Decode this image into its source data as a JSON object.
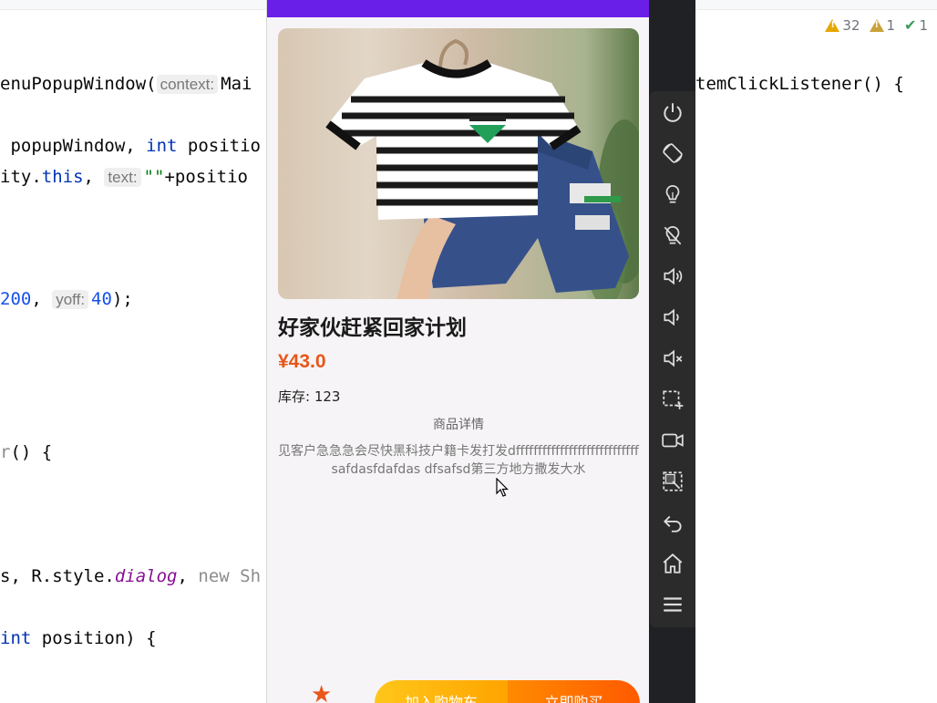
{
  "ide": {
    "inspections": {
      "warnings": "32",
      "weak_warnings": "1",
      "ok": "1"
    },
    "lines": {
      "l1_a": "enuPopupWindow(",
      "l1_hint": "context:",
      "l1_b": "Mai",
      "l1_tail": "temClickListener() {",
      "l2_a": " popupWindow, ",
      "l2_kw": "int",
      "l2_b": " positio",
      "l3_a": "ity.",
      "l3_kw": "this",
      "l3_b": ", ",
      "l3_hint": "text:",
      "l3_str": "\"\"",
      "l3_c": "+positio",
      "l4_num": "200",
      "l4_a": ", ",
      "l4_hint": "yoff:",
      "l4_num2": "40",
      "l4_b": ");",
      "l5_gray": "r",
      "l5_a": "() {",
      "l6_a": "s, R.style.",
      "l6_ital": "dialog",
      "l6_b": ", ",
      "l6_gray": "new Sh",
      "l7_kw": "int",
      "l7_a": " position) {"
    }
  },
  "product": {
    "title": "好家伙赶紧回家计划",
    "price": "¥43.0",
    "stock": "库存: 123",
    "detail_heading": "商品详情",
    "detail_text": "见客户急急急会尽快黑科技户籍卡发打发dffffffffffffffffffffffffffffsafdasfdafdas dfsafsd第三方地方撒发大水",
    "add_to_cart": "加入购物车",
    "buy_now": "立即购买"
  },
  "emulator_toolbar": [
    "power-icon",
    "rotate-icon",
    "bulb-icon",
    "bulb-off-icon",
    "volume-up-icon",
    "volume-down-icon",
    "volume-mute-icon",
    "screenshot-icon",
    "camera-record-icon",
    "screen-region-icon",
    "back-icon",
    "home-icon",
    "menu-icon"
  ],
  "colors": {
    "status_bar": "#6a1fe8",
    "price": "#e8561a",
    "cart_btn": "#ffc61a",
    "buy_btn": "#ff6a00"
  }
}
